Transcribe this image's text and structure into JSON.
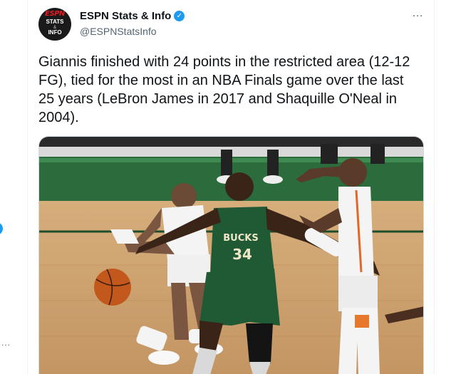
{
  "tweet": {
    "display_name": "ESPN Stats & Info",
    "handle": "@ESPNStatsInfo",
    "verified": true,
    "more_icon": "…",
    "text": "Giannis finished with 24 points in the restricted area (12-12 FG), tied for the most in an NBA Finals game over the last 25 years (LeBron James in 2017 and Shaquille O'Neal in 2004).",
    "avatar": {
      "logo_word": "ESPN",
      "line1": "STATS",
      "amp": "&",
      "line2": "INFO"
    },
    "photo": {
      "jersey_team": "BUCKS",
      "jersey_number": "34",
      "description_icon": "basketball-photo"
    }
  },
  "colors": {
    "accent": "#1d9bf0",
    "text": "#0f1419",
    "secondary": "#536471"
  }
}
